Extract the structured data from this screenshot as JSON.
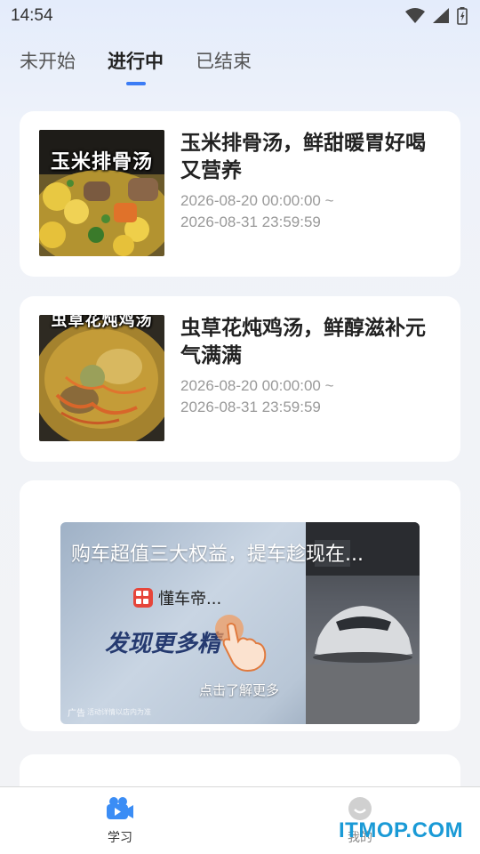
{
  "status_bar": {
    "time": "14:54"
  },
  "tabs": [
    {
      "label": "未开始",
      "active": false
    },
    {
      "label": "进行中",
      "active": true
    },
    {
      "label": "已结束",
      "active": false
    }
  ],
  "activities": [
    {
      "title": "玉米排骨汤，鲜甜暖胃好喝又营养",
      "thumb_caption": "玉米排骨汤",
      "time_start": "2026-08-20 00:00:00 ~",
      "time_end": "2026-08-31 23:59:59"
    },
    {
      "title": "虫草花炖鸡汤，鲜醇滋补元气满满",
      "thumb_caption": "虫草花炖鸡汤",
      "time_start": "2026-08-20 00:00:00 ~",
      "time_end": "2026-08-31 23:59:59"
    }
  ],
  "ad": {
    "title": "购车超值三大权益，提车趁现在...",
    "brand": "懂车帝...",
    "slogan": "发现更多精",
    "cta": "点击了解更多",
    "tag": "广告",
    "disclaimer": "活动详情以店内为准"
  },
  "bottom_nav": [
    {
      "label": "学习",
      "icon": "video-camera-icon"
    },
    {
      "label": "我的",
      "icon": "smiley-icon"
    }
  ],
  "watermark": "ITMOP.COM",
  "colors": {
    "accent": "#3b7cf5",
    "watermark": "#1a9ad6"
  }
}
